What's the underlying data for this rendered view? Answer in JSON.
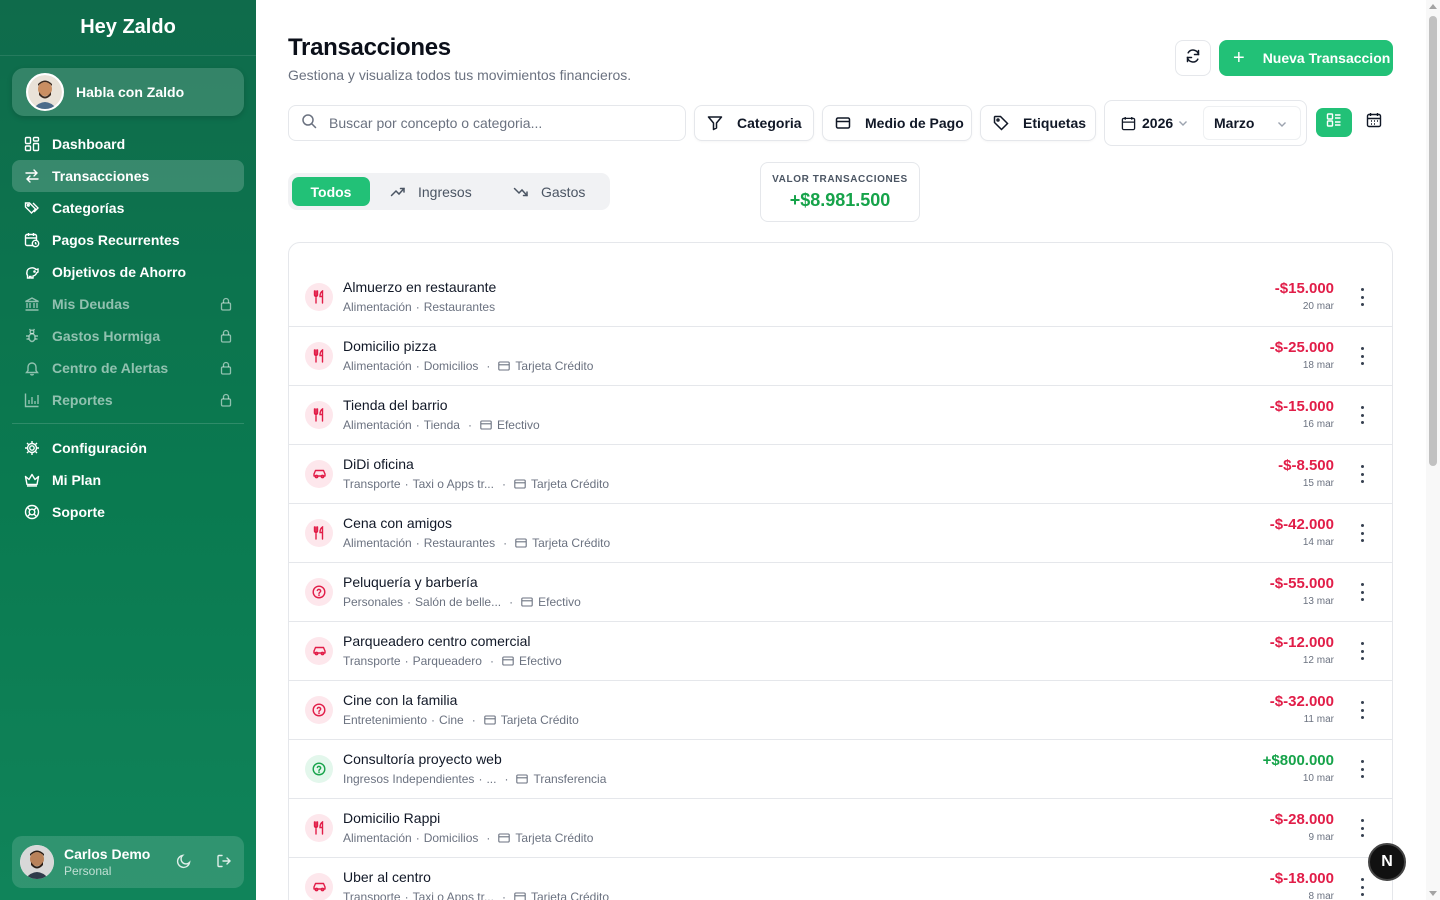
{
  "brand": "Hey Zaldo",
  "chat": {
    "label": "Habla con Zaldo"
  },
  "nav": {
    "items": [
      {
        "label": "Dashboard",
        "icon": "dashboard-icon"
      },
      {
        "label": "Transacciones",
        "icon": "arrows-icon",
        "active": true
      },
      {
        "label": "Categorías",
        "icon": "tags-icon"
      },
      {
        "label": "Pagos Recurrentes",
        "icon": "calendar-clock-icon"
      },
      {
        "label": "Objetivos de Ahorro",
        "icon": "piggy-bank-icon"
      },
      {
        "label": "Mis Deudas",
        "icon": "bank-icon",
        "locked": true
      },
      {
        "label": "Gastos Hormiga",
        "icon": "bug-icon",
        "locked": true
      },
      {
        "label": "Centro de Alertas",
        "icon": "bell-icon",
        "locked": true
      },
      {
        "label": "Reportes",
        "icon": "bar-chart-icon",
        "locked": true
      }
    ],
    "bottom": [
      {
        "label": "Configuración",
        "icon": "gear-icon"
      },
      {
        "label": "Mi Plan",
        "icon": "crown-icon"
      },
      {
        "label": "Soporte",
        "icon": "lifebuoy-icon"
      }
    ]
  },
  "user": {
    "name": "Carlos Demo",
    "plan": "Personal"
  },
  "header": {
    "title": "Transacciones",
    "subtitle": "Gestiona y visualiza todos tus movimientos financieros.",
    "new_button": "Nueva Transaccion"
  },
  "filters": {
    "search_placeholder": "Buscar por concepto o categoria...",
    "category": "Categoria",
    "payment": "Medio de Pago",
    "tags": "Etiquetas",
    "year": "2026",
    "month": "Marzo"
  },
  "tabs": {
    "all": "Todos",
    "income": "Ingresos",
    "expenses": "Gastos"
  },
  "summary": {
    "label": "VALOR TRANSACCIONES",
    "value": "+$8.981.500"
  },
  "colors": {
    "brand": "#0f6b4b",
    "accent": "#22c177",
    "negative": "#e11d48",
    "positive": "#16a34a"
  },
  "transactions": [
    {
      "title": "Almuerzo en restaurante",
      "category": "Alimentación",
      "subcategory": "Restaurantes",
      "payment": "",
      "amount": "-$15.000",
      "date": "20 mar",
      "type": "exp",
      "icon": "utensils"
    },
    {
      "title": "Domicilio pizza",
      "category": "Alimentación",
      "subcategory": "Domicilios",
      "payment": "Tarjeta Crédito",
      "amount": "-$-25.000",
      "date": "18 mar",
      "type": "exp",
      "icon": "utensils"
    },
    {
      "title": "Tienda del barrio",
      "category": "Alimentación",
      "subcategory": "Tienda",
      "payment": "Efectivo",
      "amount": "-$-15.000",
      "date": "16 mar",
      "type": "exp",
      "icon": "utensils"
    },
    {
      "title": "DiDi oficina",
      "category": "Transporte",
      "subcategory": "Taxi o Apps tr...",
      "payment": "Tarjeta Crédito",
      "amount": "-$-8.500",
      "date": "15 mar",
      "type": "exp",
      "icon": "car"
    },
    {
      "title": "Cena con amigos",
      "category": "Alimentación",
      "subcategory": "Restaurantes",
      "payment": "Tarjeta Crédito",
      "amount": "-$-42.000",
      "date": "14 mar",
      "type": "exp",
      "icon": "utensils"
    },
    {
      "title": "Peluquería y barbería",
      "category": "Personales",
      "subcategory": "Salón de belle...",
      "payment": "Efectivo",
      "amount": "-$-55.000",
      "date": "13 mar",
      "type": "exp",
      "icon": "help"
    },
    {
      "title": "Parqueadero centro comercial",
      "category": "Transporte",
      "subcategory": "Parqueadero",
      "payment": "Efectivo",
      "amount": "-$-12.000",
      "date": "12 mar",
      "type": "exp",
      "icon": "car"
    },
    {
      "title": "Cine con la familia",
      "category": "Entretenimiento",
      "subcategory": "Cine",
      "payment": "Tarjeta Crédito",
      "amount": "-$-32.000",
      "date": "11 mar",
      "type": "exp",
      "icon": "help"
    },
    {
      "title": "Consultoría proyecto web",
      "category": "Ingresos Independientes",
      "subcategory": "...",
      "payment": "Transferencia",
      "amount": "+$800.000",
      "date": "10 mar",
      "type": "inc",
      "icon": "help"
    },
    {
      "title": "Domicilio Rappi",
      "category": "Alimentación",
      "subcategory": "Domicilios",
      "payment": "Tarjeta Crédito",
      "amount": "-$-28.000",
      "date": "9 mar",
      "type": "exp",
      "icon": "utensils"
    },
    {
      "title": "Uber al centro",
      "category": "Transporte",
      "subcategory": "Taxi o Apps tr...",
      "payment": "Tarjeta Crédito",
      "amount": "-$-18.000",
      "date": "8 mar",
      "type": "exp",
      "icon": "car"
    }
  ],
  "badge": "N"
}
